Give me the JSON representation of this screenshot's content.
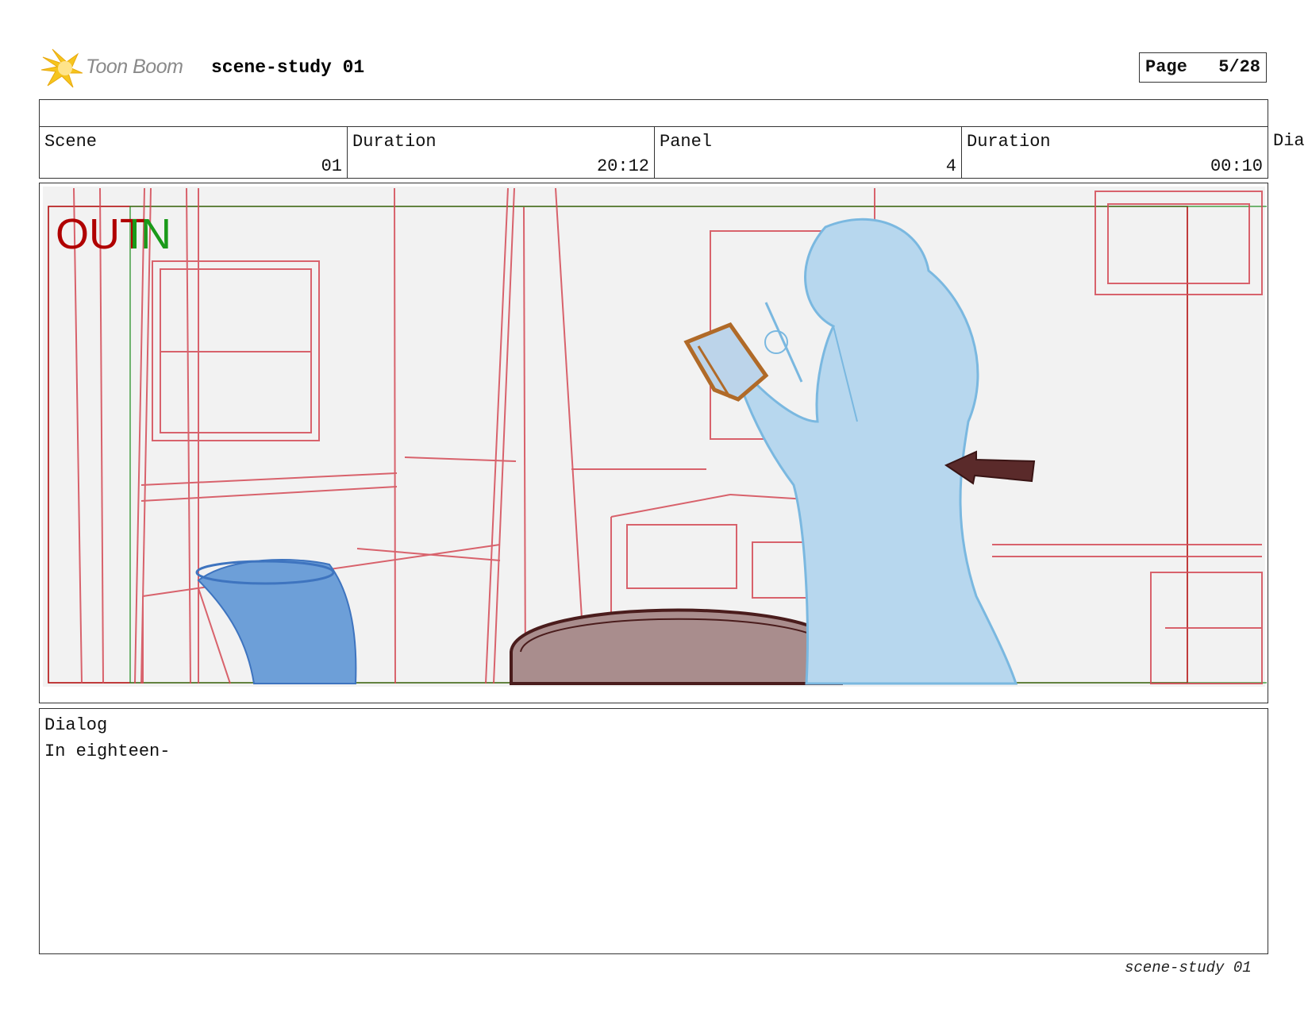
{
  "header": {
    "brand": "Toon Boom",
    "project_title": "scene-study 01",
    "page_label": "Page",
    "page_value": "5/28"
  },
  "info_row": {
    "cells": [
      {
        "label": "Scene",
        "value": "01"
      },
      {
        "label": "Duration",
        "value": "20:12"
      },
      {
        "label": "Panel",
        "value": "4"
      },
      {
        "label": "Duration",
        "value": "00:10"
      }
    ],
    "overflow_label": "Dia"
  },
  "panel": {
    "overlay_out": "OUT",
    "overlay_in": "IN",
    "colors": {
      "out": "#b00000",
      "in": "#1a9a1a",
      "layout": "#d44a55",
      "character": "#7ab8e0",
      "book": "#b06a28"
    }
  },
  "dialog": {
    "label": "Dialog",
    "text": "In eighteen-"
  },
  "footer": {
    "text": "scene-study 01"
  }
}
